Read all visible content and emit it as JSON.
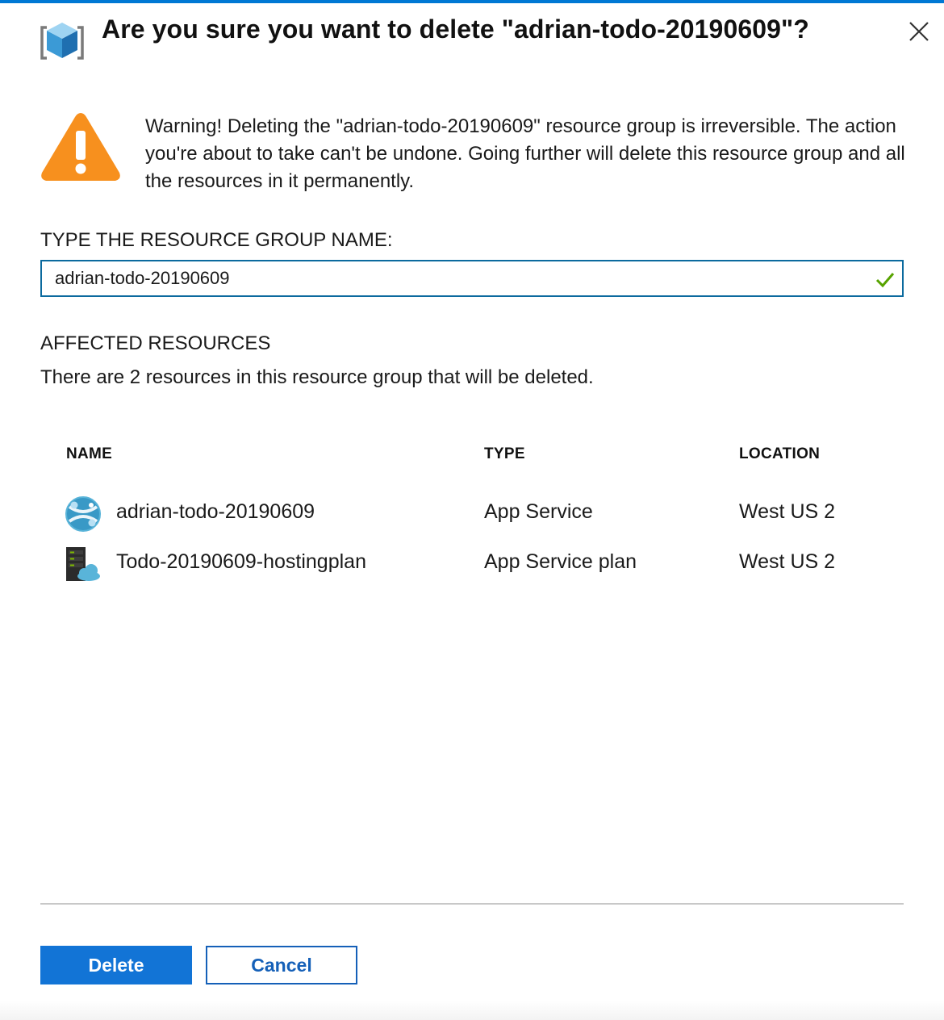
{
  "dialog": {
    "title": "Are you sure you want to delete \"adrian-todo-20190609\"?",
    "header_icon": "resource-group-cube-icon",
    "close_icon": "close-icon"
  },
  "warning": {
    "icon": "warning-triangle-icon",
    "text": "Warning! Deleting the \"adrian-todo-20190609\" resource group is irreversible. The action you're about to take can't be undone. Going further will delete this resource group and all the resources in it permanently."
  },
  "confirm_field": {
    "label": "TYPE THE RESOURCE GROUP NAME:",
    "value": "adrian-todo-20190609",
    "valid_icon": "checkmark-icon"
  },
  "affected": {
    "title": "AFFECTED RESOURCES",
    "description": "There are 2 resources in this resource group that will be deleted.",
    "columns": {
      "name": "NAME",
      "type": "TYPE",
      "location": "LOCATION"
    },
    "rows": [
      {
        "name": "adrian-todo-20190609",
        "type": "App Service",
        "location": "West US 2",
        "icon": "app-service-globe-icon"
      },
      {
        "name": "Todo-20190609-hostingplan",
        "type": "App Service plan",
        "location": "West US 2",
        "icon": "app-service-plan-server-icon"
      }
    ]
  },
  "buttons": {
    "delete": "Delete",
    "cancel": "Cancel"
  },
  "colors": {
    "accent": "#0078d4",
    "delete_button": "#1274d6",
    "warning": "#f7901e",
    "valid_check": "#57a300"
  }
}
